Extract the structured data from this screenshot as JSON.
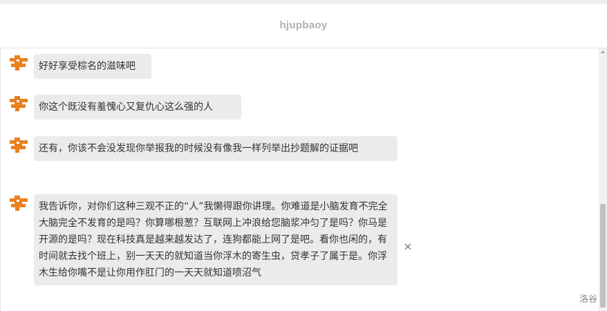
{
  "header": {
    "title": "hjupbaoy"
  },
  "colors": {
    "avatar": "#e8801e",
    "bubble": "#ebebeb"
  },
  "messages": [
    {
      "text": "好好享受棕名的滋味吧"
    },
    {
      "text": "你这个既没有羞愧心又复仇心这么强的人"
    },
    {
      "text": "还有，你该不会没发现你举报我的时候没有像我一样列举出抄题解的证据吧"
    },
    {
      "text": "我告诉你，对你们这种三观不正的“人”我懒得跟你讲理。你难道是小脑发育不完全大脑完全不发育的是吗？你算哪根葱？互联网上冲浪给您脑浆冲匀了是吗？你马是开源的是吗？现在科技真是越来越发达了，连狗都能上网了是吧。看你也闲的，有时间就去找个班上，别一天天的就知道当你浮木的寄生虫，贷孝子了属于是。你浮木生给你嘴不是让你用作肛门的一天天就知道喷沼气"
    }
  ],
  "close_label": "×",
  "watermark": "洛谷"
}
